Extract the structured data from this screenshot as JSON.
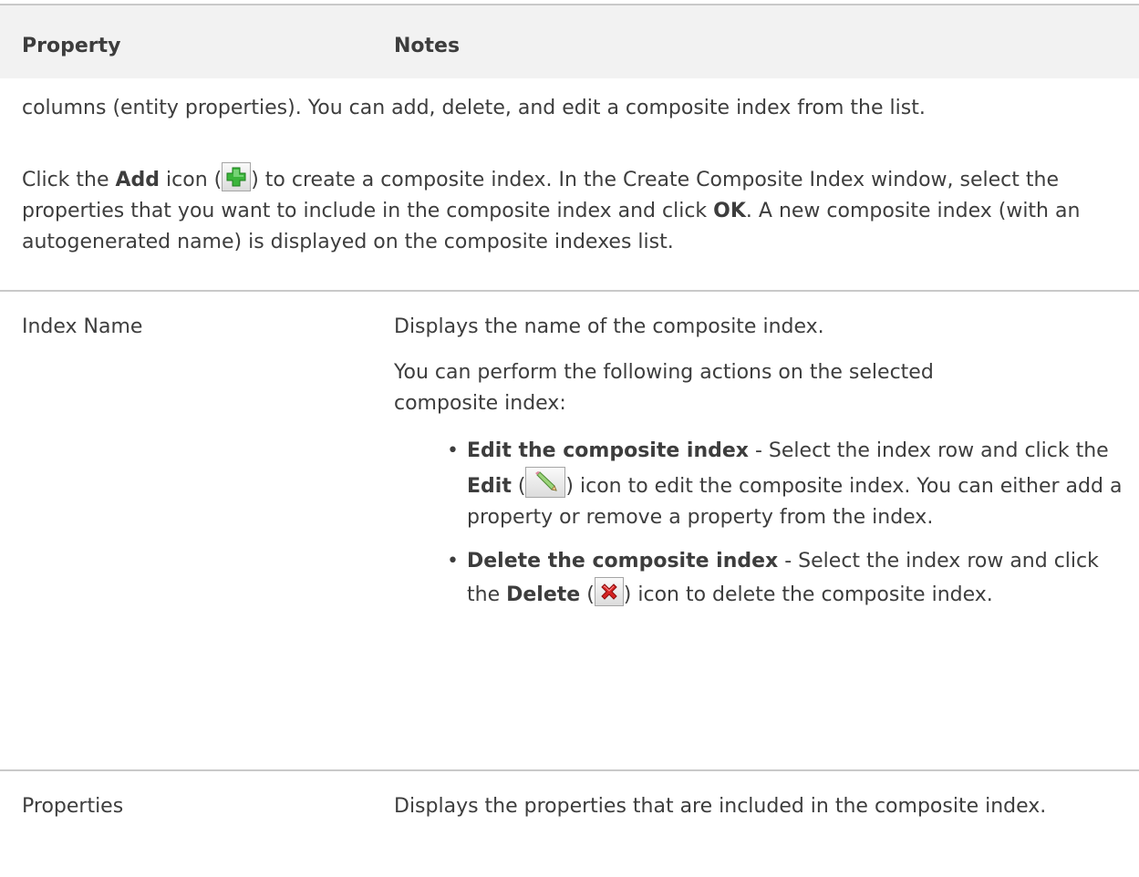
{
  "table": {
    "headers": {
      "property": "Property",
      "notes": "Notes"
    },
    "intro": {
      "line1": "columns (entity properties). You can add, delete, and edit a composite index from the list.",
      "p2_click": "Click the ",
      "p2_add": "Add",
      "p2_icon_pre": " icon (",
      "p2_icon_post": ") to create a composite index. In the Create Composite Index window, select the properties that you want to include in the composite index and click ",
      "p2_ok": "OK",
      "p2_end": ". A new composite index (with an autogenerated name) is displayed on the composite indexes list."
    },
    "rows": [
      {
        "property": "Index Name",
        "notes_p1": "Displays the name of the composite index.",
        "notes_p2": "You can perform the following actions on the selected composite index:",
        "bullets": [
          {
            "title": "Edit the composite index",
            "pre": " - Select the index row and click the ",
            "action": "Edit",
            "open": " (",
            "post": ") icon to edit the composite index. You can either add a property or remove a property from the index.",
            "icon": "pencil-icon"
          },
          {
            "title": "Delete the composite index",
            "pre": " - Select the index row and click the ",
            "action": "Delete",
            "open": " (",
            "post": ") icon to delete the composite index.",
            "icon": "red-x-icon"
          }
        ]
      },
      {
        "property": "Properties",
        "notes_p1": "Displays the properties that are included in the composite index."
      }
    ]
  },
  "icons": {
    "add": "green-plus-icon",
    "edit": "pencil-icon",
    "delete": "red-x-icon"
  },
  "colors": {
    "text": "#3d3d3d",
    "header_bg": "#f2f2f2",
    "rule": "#c9c9c9",
    "plus_green": "#3bb53b",
    "x_red": "#d62222"
  }
}
